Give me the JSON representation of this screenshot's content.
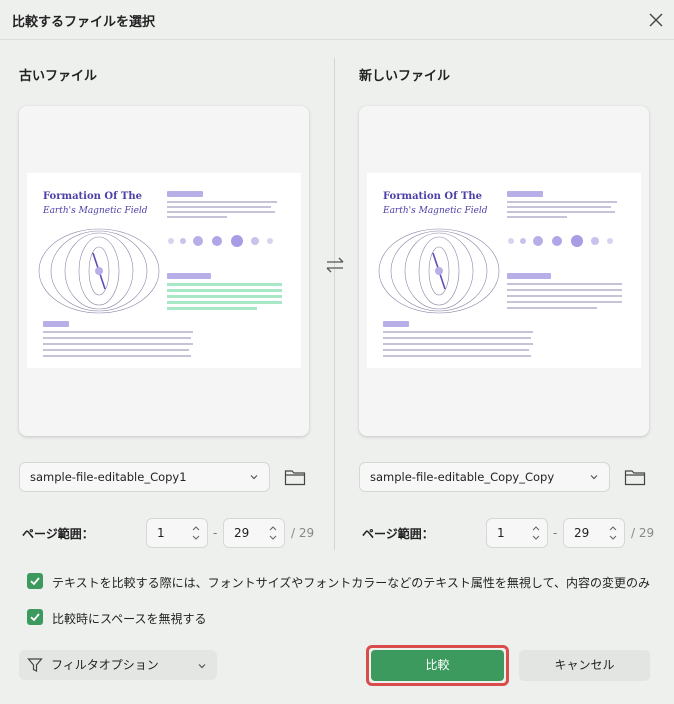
{
  "window": {
    "title": "比較するファイルを選択",
    "close_icon": "close-icon"
  },
  "old_file": {
    "heading": "古いファイル",
    "document": {
      "title_line1": "Formation Of The",
      "title_line2": "Earth's Magnetic Field"
    },
    "file_name": "sample-file-editable_Copy1",
    "page_range_label": "ページ範囲：",
    "page_from": "1",
    "page_to": "29",
    "page_total": "/ 29",
    "range_dash": "-"
  },
  "new_file": {
    "heading": "新しいファイル",
    "document": {
      "title_line1": "Formation Of The",
      "title_line2": "Earth's Magnetic Field"
    },
    "file_name": "sample-file-editable_Copy_Copy",
    "page_range_label": "ページ範囲：",
    "page_from": "1",
    "page_to": "29",
    "page_total": "/ 29",
    "range_dash": "-"
  },
  "options": {
    "ignore_attributes": {
      "label": "テキストを比較する際には、フォントサイズやフォントカラーなどのテキスト属性を無視して、内容の変更のみ",
      "checked": true
    },
    "ignore_spaces": {
      "label": "比較時にスペースを無視する",
      "checked": true
    }
  },
  "footer": {
    "filter_label": "フィルタオプション",
    "compare_label": "比較",
    "cancel_label": "キャンセル"
  },
  "colors": {
    "accent_green": "#3c9a5f",
    "highlight_red": "#d94c4c",
    "doc_purple": "#4b3fa8"
  }
}
